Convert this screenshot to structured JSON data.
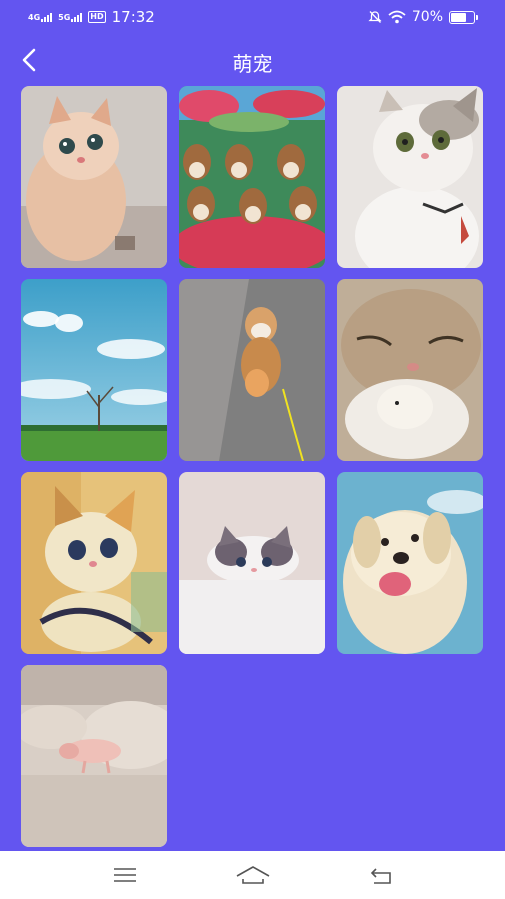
{
  "status": {
    "network_1": "4G",
    "network_2": "5G",
    "hd": "HD",
    "time": "17:32",
    "battery": "70%",
    "battery_level": 0.7,
    "icons": [
      "mute-icon",
      "wifi-icon",
      "battery-icon"
    ]
  },
  "header": {
    "title": "萌宠",
    "back_icon": "chevron-left-icon"
  },
  "gallery": {
    "items": [
      {
        "name": "pet-image-1",
        "subject": "cat"
      },
      {
        "name": "pet-image-2",
        "subject": "dogs"
      },
      {
        "name": "pet-image-3",
        "subject": "cat"
      },
      {
        "name": "pet-image-4",
        "subject": "sky-landscape"
      },
      {
        "name": "pet-image-5",
        "subject": "puppy"
      },
      {
        "name": "pet-image-6",
        "subject": "cat"
      },
      {
        "name": "pet-image-7",
        "subject": "kitten"
      },
      {
        "name": "pet-image-8",
        "subject": "cat"
      },
      {
        "name": "pet-image-9",
        "subject": "dog"
      },
      {
        "name": "pet-image-10",
        "subject": "piglet"
      }
    ]
  },
  "nav": {
    "icons": [
      "menu-icon",
      "home-icon",
      "back-icon"
    ]
  },
  "colors": {
    "background": "#6355f0",
    "nav_background": "#ffffff",
    "nav_icon": "#555555"
  }
}
